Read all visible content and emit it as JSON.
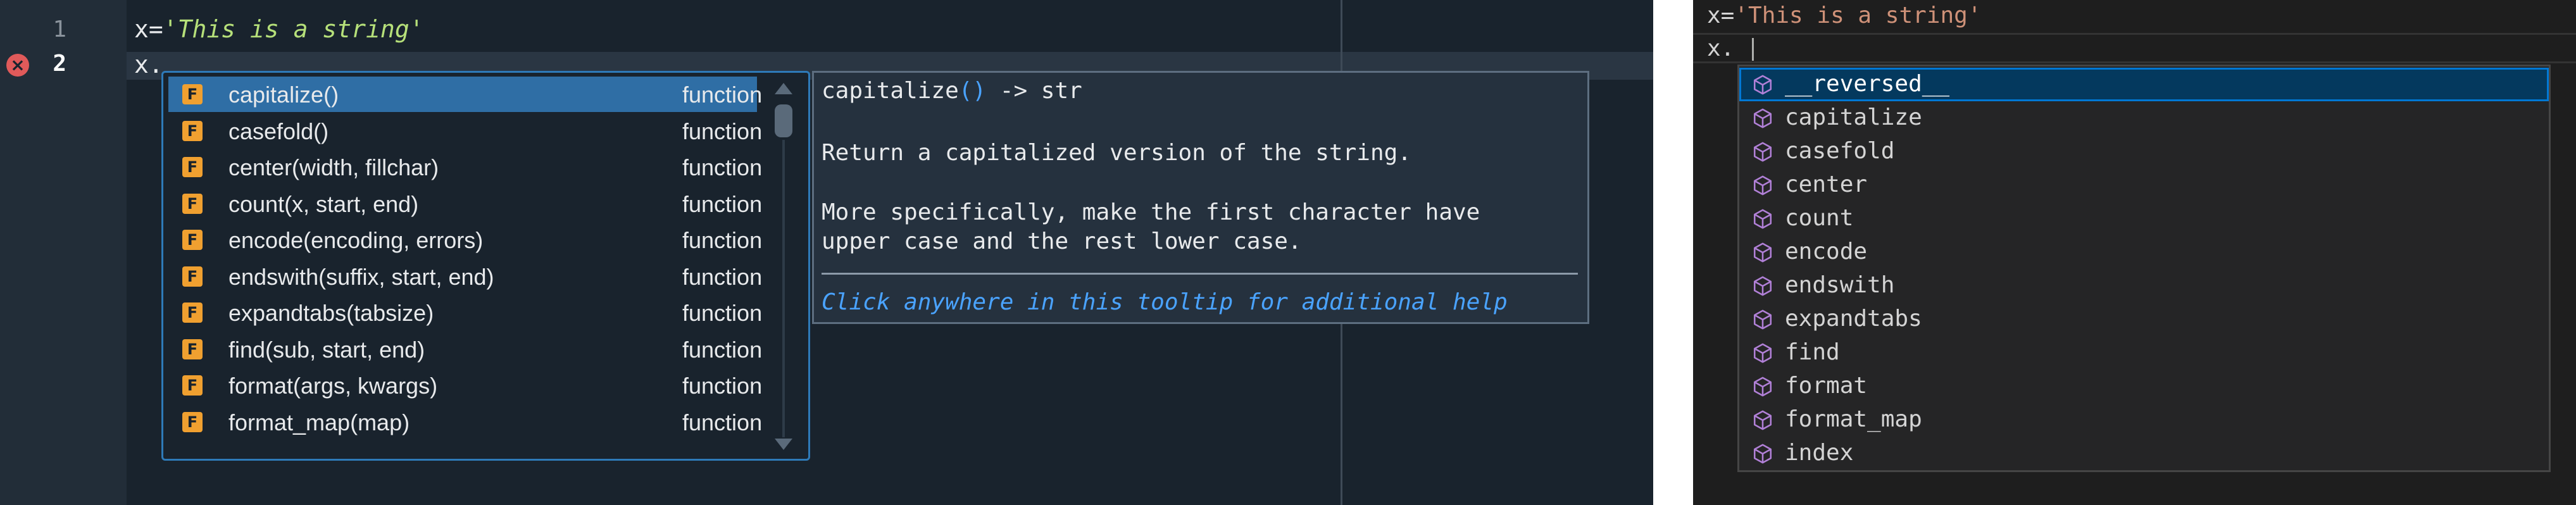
{
  "left_editor": {
    "line_numbers": [
      "1",
      "2"
    ],
    "line1": {
      "var": "x=",
      "string": "'This is a string'"
    },
    "line2": "x.",
    "completion_items": [
      {
        "icon": "F",
        "name": "capitalize()",
        "kind": "function",
        "selected": true
      },
      {
        "icon": "F",
        "name": "casefold()",
        "kind": "function"
      },
      {
        "icon": "F",
        "name": "center(width, fillchar)",
        "kind": "function"
      },
      {
        "icon": "F",
        "name": "count(x, start, end)",
        "kind": "function"
      },
      {
        "icon": "F",
        "name": "encode(encoding, errors)",
        "kind": "function"
      },
      {
        "icon": "F",
        "name": "endswith(suffix, start, end)",
        "kind": "function"
      },
      {
        "icon": "F",
        "name": "expandtabs(tabsize)",
        "kind": "function"
      },
      {
        "icon": "F",
        "name": "find(sub, start, end)",
        "kind": "function"
      },
      {
        "icon": "F",
        "name": "format(args, kwargs)",
        "kind": "function"
      },
      {
        "icon": "F",
        "name": "format_map(map)",
        "kind": "function"
      }
    ],
    "tooltip": {
      "sig_name": "capitalize",
      "sig_parens": "()",
      "sig_ret": " -> str",
      "line1": "Return a capitalized version of the string.",
      "line2": "More specifically, make the first character have",
      "line3": "upper case and the rest lower case.",
      "help": "Click anywhere in this tooltip for additional help"
    }
  },
  "right_editor": {
    "line1": {
      "var": "x=",
      "string": "'This is a string'"
    },
    "line2": "x.",
    "suggestions": [
      {
        "icon": "cube-icon",
        "name": "__reversed__",
        "selected": true
      },
      {
        "icon": "cube-icon",
        "name": "capitalize"
      },
      {
        "icon": "cube-icon",
        "name": "casefold"
      },
      {
        "icon": "cube-icon",
        "name": "center"
      },
      {
        "icon": "cube-icon",
        "name": "count"
      },
      {
        "icon": "cube-icon",
        "name": "encode"
      },
      {
        "icon": "cube-icon",
        "name": "endswith"
      },
      {
        "icon": "cube-icon",
        "name": "expandtabs"
      },
      {
        "icon": "cube-icon",
        "name": "find"
      },
      {
        "icon": "cube-icon",
        "name": "format"
      },
      {
        "icon": "cube-icon",
        "name": "format_map"
      },
      {
        "icon": "cube-icon",
        "name": "index"
      }
    ]
  },
  "colors": {
    "spyder_bg": "#19232d",
    "spyder_selection": "#2f6ea5",
    "function_icon": "#f0a030",
    "vscode_bg": "#1e1e1e",
    "vscode_selection": "#04395e",
    "method_icon": "#b180d7"
  }
}
